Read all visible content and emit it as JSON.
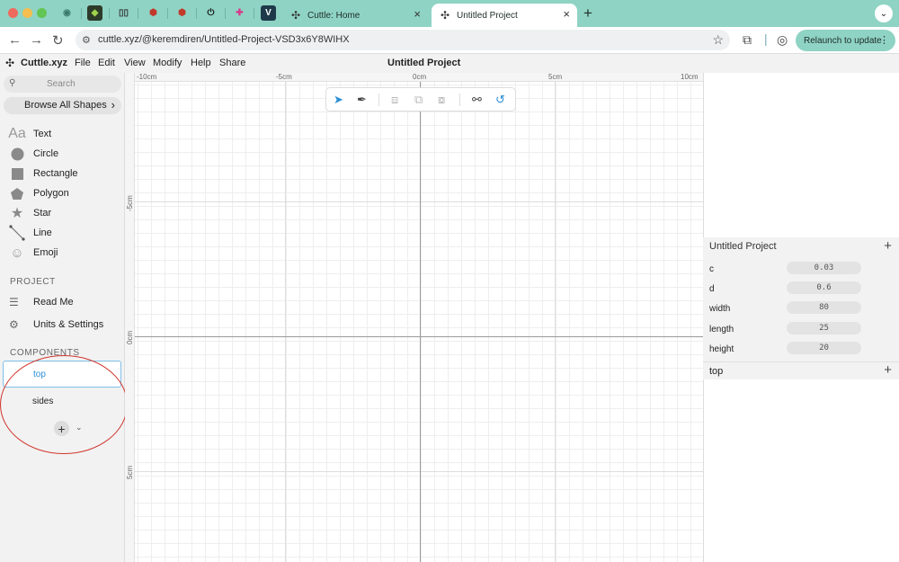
{
  "browser": {
    "tabs": [
      {
        "title": "Cuttle: Home",
        "active": false
      },
      {
        "title": "Untitled Project",
        "active": true
      }
    ],
    "new_tab": "+",
    "url": "cuttle.xyz/@keremdiren/Untitled-Project-VSD3x6Y8WIHX",
    "relaunch_label": "Relaunch to update"
  },
  "app": {
    "name": "Cuttle.xyz",
    "menu": [
      "File",
      "Edit",
      "View",
      "Modify",
      "Help",
      "Share"
    ],
    "doc_title": "Untitled Project"
  },
  "sidebar": {
    "search_placeholder": "Search",
    "browse_label": "Browse All Shapes",
    "shapes": [
      {
        "label": "Text",
        "icon": "text-icon"
      },
      {
        "label": "Circle",
        "icon": "circle-icon"
      },
      {
        "label": "Rectangle",
        "icon": "rectangle-icon"
      },
      {
        "label": "Polygon",
        "icon": "polygon-icon"
      },
      {
        "label": "Star",
        "icon": "star-icon"
      },
      {
        "label": "Line",
        "icon": "line-icon"
      },
      {
        "label": "Emoji",
        "icon": "emoji-icon"
      }
    ],
    "text_glyph": "Aa",
    "project_heading": "PROJECT",
    "project_items": [
      {
        "label": "Read Me",
        "icon": "readme-icon"
      },
      {
        "label": "Units & Settings",
        "icon": "settings-icon"
      }
    ],
    "components_heading": "COMPONENTS",
    "components": [
      {
        "label": "top",
        "selected": true
      },
      {
        "label": "sides",
        "selected": false
      }
    ]
  },
  "canvas": {
    "ruler_x": [
      "-10cm",
      "-5cm",
      "0cm",
      "5cm",
      "10cm"
    ],
    "ruler_y": [
      "-5cm",
      "0cm",
      "5cm"
    ]
  },
  "params": {
    "heading": "Untitled Project",
    "rows": [
      {
        "name": "c",
        "value": "0.03"
      },
      {
        "name": "d",
        "value": "0.6"
      },
      {
        "name": "width",
        "value": "80"
      },
      {
        "name": "length",
        "value": "25"
      },
      {
        "name": "height",
        "value": "20"
      }
    ]
  },
  "component_panel": {
    "label": "top"
  },
  "colors": {
    "chrome_accent": "#8fd3c4",
    "selection_blue": "#2a8fd6",
    "annotation_red": "#d0352c"
  }
}
